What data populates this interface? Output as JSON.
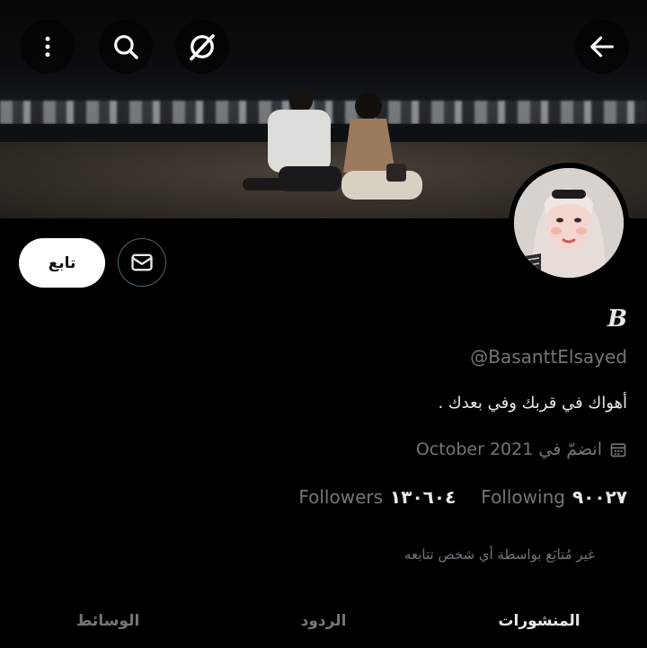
{
  "header": {
    "back_icon": "arrow-left-icon",
    "grok_icon": "grok-icon",
    "search_icon": "search-icon",
    "more_icon": "more-vertical-icon"
  },
  "profile": {
    "display_name": "B",
    "handle": "@BasanttElsayed",
    "bio": "أهواك في قربك وفي بعدك .",
    "joined": "انضمّ في October 2021",
    "following_count": "٩٠٠٢٧",
    "following_label": "Following",
    "followers_count": "١٣٠٦٠٤",
    "followers_label": "Followers",
    "not_followed_text": "غير مُتابَع بواسطة أي شخص تتابعه"
  },
  "actions": {
    "follow_label": "تابع",
    "message_icon": "envelope-icon"
  },
  "tabs": [
    {
      "label": "المنشورات",
      "active": true
    },
    {
      "label": "الردود",
      "active": false
    },
    {
      "label": "الوسائط",
      "active": false
    }
  ]
}
